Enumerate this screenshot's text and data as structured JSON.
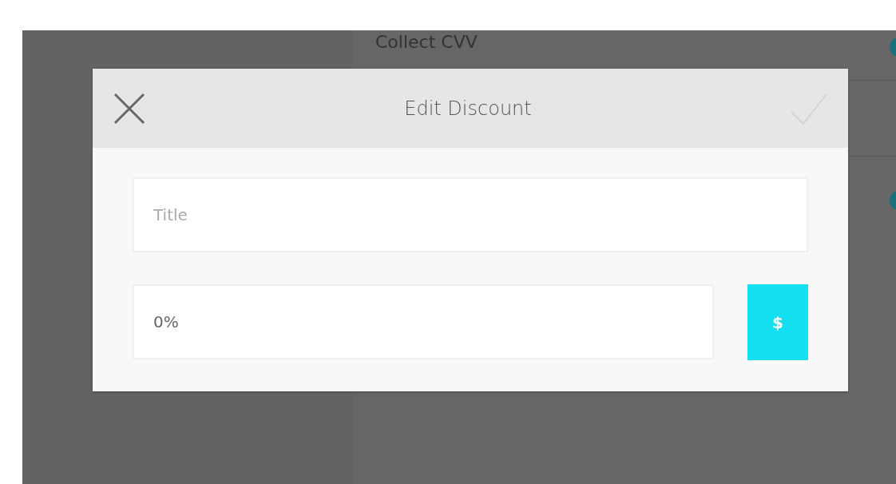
{
  "background": {
    "row_label": "Collect CVV"
  },
  "dialog": {
    "title": "Edit Discount",
    "title_field": {
      "placeholder": "Title"
    },
    "amount_field": {
      "value": "0%"
    },
    "unit_button": {
      "label": "$"
    }
  }
}
